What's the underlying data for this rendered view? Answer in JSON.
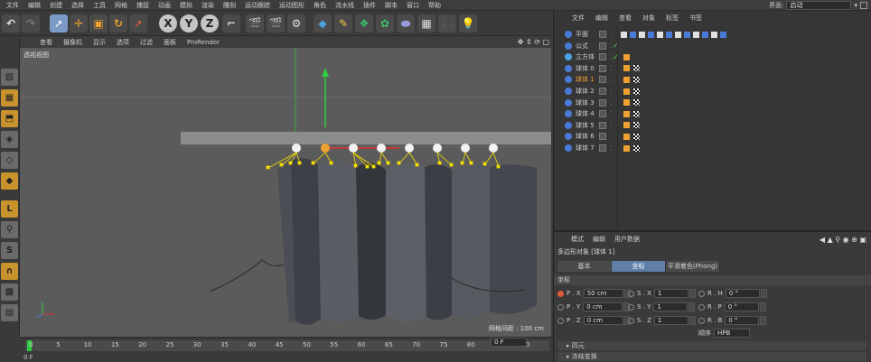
{
  "menubar": {
    "items": [
      "文件",
      "编辑",
      "创建",
      "选择",
      "工具",
      "网格",
      "捕捉",
      "动画",
      "模拟",
      "渲染",
      "雕刻",
      "运动跟踪",
      "运动图形",
      "角色",
      "流水线",
      "插件",
      "脚本",
      "窗口",
      "帮助"
    ],
    "layout_label": "界面:",
    "layout_value": "启动"
  },
  "toolbar": {
    "icons": [
      "undo-icon",
      "redo-icon",
      "select-icon",
      "move-icon",
      "scale-icon",
      "rotate-icon",
      "live-select-icon",
      "x-axis-icon",
      "y-axis-icon",
      "z-axis-icon",
      "coordinate-system-icon",
      "render-view-icon",
      "render-picture-viewer-icon",
      "edit-render-settings-icon",
      "cube-icon",
      "pen-icon",
      "subdivision-icon",
      "array-icon",
      "deformer-icon",
      "floor-icon",
      "camera-icon",
      "light-icon"
    ],
    "axis_labels": [
      "X",
      "Y",
      "Z"
    ]
  },
  "viewport": {
    "menu": [
      "查看",
      "摄像机",
      "显示",
      "选项",
      "过滤",
      "面板",
      "ProRender"
    ],
    "label": "透视视图",
    "grid_distance": "网格间距 : 100 cm"
  },
  "timeline": {
    "ticks": [
      "0",
      "5",
      "10",
      "15",
      "20",
      "25",
      "30",
      "35",
      "40",
      "45",
      "50",
      "55",
      "60",
      "65",
      "70",
      "75",
      "80",
      "85",
      "90"
    ],
    "current_frame": "0 F",
    "frame_value": "0 F"
  },
  "object_manager": {
    "menu": [
      "文件",
      "编辑",
      "查看",
      "对象",
      "标签",
      "书签"
    ],
    "objects": [
      {
        "name": "平面",
        "type": "plane"
      },
      {
        "name": "公式",
        "type": "formula"
      },
      {
        "name": "立方体",
        "type": "cube"
      },
      {
        "name": "球体 0",
        "type": "sphere"
      },
      {
        "name": "球体 1",
        "type": "sphere",
        "selected": true
      },
      {
        "name": "球体 2",
        "type": "sphere"
      },
      {
        "name": "球体 3",
        "type": "sphere"
      },
      {
        "name": "球体 4",
        "type": "sphere"
      },
      {
        "name": "球体 5",
        "type": "sphere"
      },
      {
        "name": "球体 6",
        "type": "sphere"
      },
      {
        "name": "球体 7",
        "type": "sphere"
      }
    ]
  },
  "attributes": {
    "menu": [
      "模式",
      "编辑",
      "用户数据"
    ],
    "title": "多边形对象 [球体 1]",
    "tabs": [
      "基本",
      "坐标",
      "平滑着色(Phong)"
    ],
    "active_tab": "坐标",
    "section": "坐标",
    "position": {
      "label_x": "P . X",
      "x": "50 cm",
      "label_y": "P . Y",
      "y": "0 cm",
      "label_z": "P . Z",
      "z": "0 cm"
    },
    "scale": {
      "label_x": "S . X",
      "x": "1",
      "label_y": "S . Y",
      "y": "1",
      "label_z": "S . Z",
      "z": "1"
    },
    "rotation": {
      "label_h": "R . H",
      "h": "0 °",
      "label_p": "R . P",
      "p": "0 °",
      "label_b": "R . B",
      "b": "0 °"
    },
    "order_label": "顺序",
    "order_value": "HPB",
    "collapsed_sections": [
      "四元",
      "冻结变换"
    ]
  },
  "colors": {
    "accent_blue": "#5f7fa8",
    "selected_orange": "#f0a030",
    "axis_green": "#2ecc40",
    "handle_yellow": "#f5e000"
  }
}
